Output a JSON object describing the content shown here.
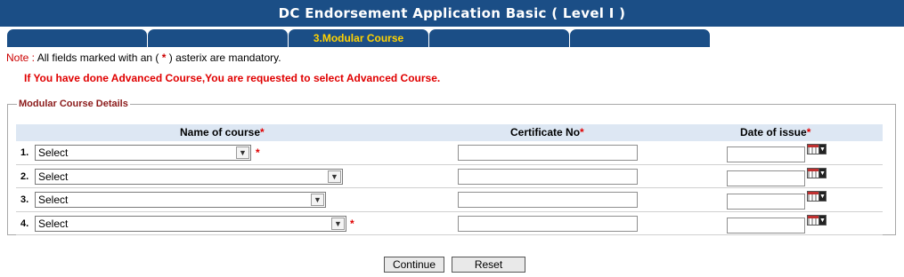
{
  "header": {
    "title": "DC Endorsement Application Basic ( Level I )"
  },
  "tabs": [
    {
      "label": "",
      "active": false
    },
    {
      "label": "",
      "active": false
    },
    {
      "label": "3.Modular Course",
      "active": true
    },
    {
      "label": "",
      "active": false
    },
    {
      "label": "",
      "active": false
    }
  ],
  "note": {
    "prefix": "Note :",
    "text_before": " All fields marked with an ( ",
    "asterisk": "*",
    "text_after": " ) asterix are mandatory."
  },
  "advice": "If You have done Advanced Course,You are requested to select Advanced Course.",
  "section": {
    "legend": "Modular Course Details",
    "columns": {
      "course": "Name of course",
      "certificate": "Certificate No",
      "date": "Date of issue",
      "required_mark": "*"
    },
    "rows": [
      {
        "num": "1.",
        "course_value": "Select",
        "certificate_value": "",
        "date_value": "",
        "required": true
      },
      {
        "num": "2.",
        "course_value": "Select",
        "certificate_value": "",
        "date_value": "",
        "required": false
      },
      {
        "num": "3.",
        "course_value": "Select",
        "certificate_value": "",
        "date_value": "",
        "required": false
      },
      {
        "num": "4.",
        "course_value": "Select",
        "certificate_value": "",
        "date_value": "",
        "required": true
      }
    ]
  },
  "buttons": {
    "continue": "Continue",
    "reset": "Reset"
  },
  "colors": {
    "header_bg": "#1b4e86",
    "tab_text": "#ffd200",
    "required": "#e00000",
    "legend": "#8b1a1a",
    "grid_header_bg": "#dde7f3"
  },
  "icons": {
    "calendar": "calendar-icon",
    "dropdown": "chevron-down-icon"
  }
}
